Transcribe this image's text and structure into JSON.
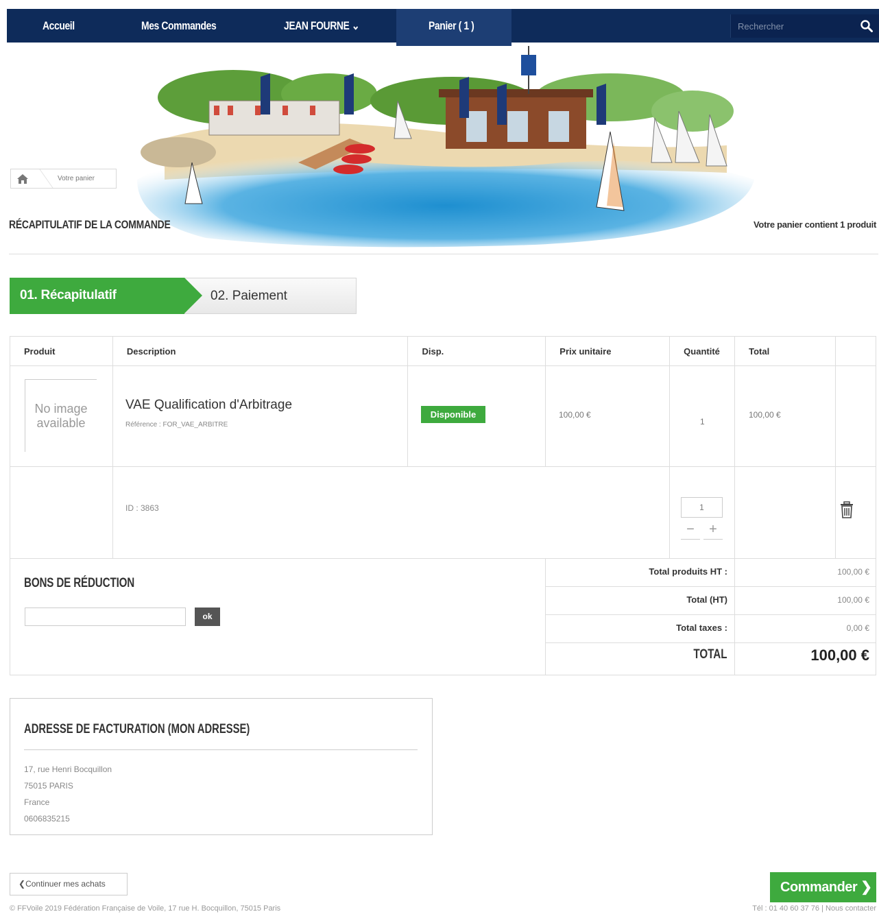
{
  "nav": {
    "home": "Accueil",
    "orders": "Mes Commandes",
    "user": "JEAN FOURNE",
    "cart": "Panier ( 1 )",
    "search_placeholder": "Rechercher"
  },
  "breadcrumb": {
    "current": "Votre panier"
  },
  "heading": {
    "title": "RÉCAPITULATIF DE LA COMMANDE",
    "cart_count": "Votre panier contient 1 produit"
  },
  "steps": [
    "01. Récapitulatif",
    "02. Paiement"
  ],
  "table": {
    "headers": [
      "Produit",
      "Description",
      "Disp.",
      "Prix unitaire",
      "Quantité",
      "Total"
    ],
    "item": {
      "no_image_line1": "No image",
      "no_image_line2": "available",
      "title": "VAE Qualification d'Arbitrage",
      "reference": "Référence : FOR_VAE_ARBITRE",
      "availability": "Disponible",
      "unit_price": "100,00 €",
      "quantity": "1",
      "total": "100,00 €",
      "id_label": "ID : 3863",
      "qty_input": "1",
      "minus": "−",
      "plus": "+"
    }
  },
  "coupon": {
    "title": "BONS DE RÉDUCTION",
    "button": "ok"
  },
  "totals": {
    "products_ht_label": "Total produits HT :",
    "products_ht_value": "100,00 €",
    "total_ht_label": "Total (HT)",
    "total_ht_value": "100,00 €",
    "taxes_label": "Total taxes :",
    "taxes_value": "0,00 €",
    "grand_label": "TOTAL",
    "grand_value": "100,00 €"
  },
  "address": {
    "title": "ADRESSE DE FACTURATION (MON ADRESSE)",
    "lines": [
      "17, rue Henri Bocquillon",
      "75015 PARIS",
      "France",
      "0606835215"
    ]
  },
  "buttons": {
    "continue": "Continuer mes achats",
    "checkout": "Commander"
  },
  "footer": {
    "left": "© FFVoile 2019 Fédération Française de Voile, 17 rue H. Bocquillon, 75015 Paris",
    "right": "Tél : 01 40 60 37 76 | Nous contacter"
  },
  "colors": {
    "navy": "#0e2b5a",
    "green": "#3eaa3e"
  }
}
